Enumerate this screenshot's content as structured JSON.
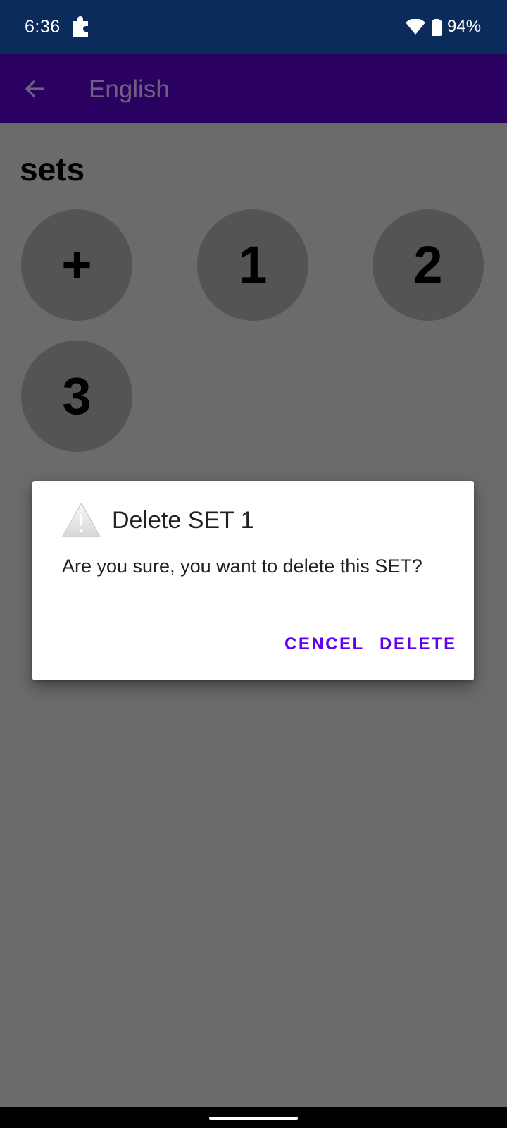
{
  "status_bar": {
    "time": "6:36",
    "battery_percent": "94%",
    "background_color": "#0a2b5c",
    "icons": [
      "puzzle-icon",
      "wifi-icon",
      "battery-icon"
    ]
  },
  "app_bar": {
    "title": "English",
    "back_icon": "arrow-left-icon",
    "background_color": "#2a0061"
  },
  "main": {
    "section_title": "sets",
    "sets": [
      {
        "label": "+"
      },
      {
        "label": "1"
      },
      {
        "label": "2"
      },
      {
        "label": "3"
      }
    ]
  },
  "dialog": {
    "icon": "warning-icon",
    "title": "Delete SET 1",
    "message": "Are you sure, you want to delete this SET?",
    "cancel_label": "CENCEL",
    "delete_label": "DELETE",
    "accent_color": "#6200ee"
  }
}
